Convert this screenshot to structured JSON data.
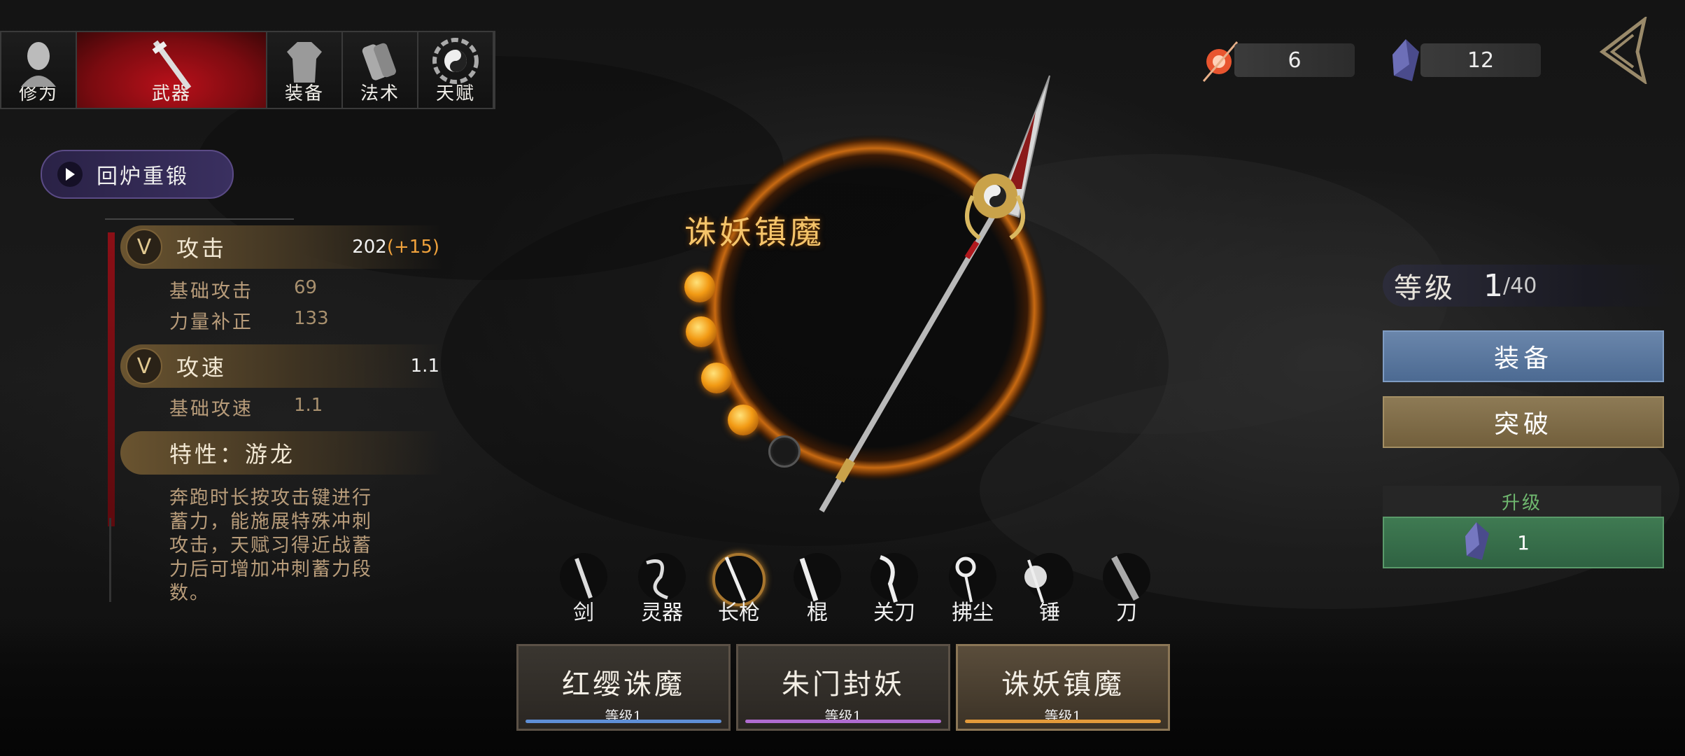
{
  "tabs": [
    {
      "label": "修为",
      "icon": "monk-portrait-icon"
    },
    {
      "label": "武器",
      "icon": "sword-icon",
      "active": true
    },
    {
      "label": "装备",
      "icon": "robe-icon"
    },
    {
      "label": "法术",
      "icon": "scroll-icon"
    },
    {
      "label": "天赋",
      "icon": "bagua-icon"
    }
  ],
  "currency": [
    {
      "icon": "fire-orb-icon",
      "value": "6"
    },
    {
      "icon": "crystal-icon",
      "value": "12"
    }
  ],
  "reforge_label": "回炉重锻",
  "stats": {
    "attack": {
      "name": "攻击",
      "value": "202",
      "bonus": "(+15)",
      "rows": [
        {
          "label": "基础攻击",
          "value": "69"
        },
        {
          "label": "力量补正",
          "value": "133"
        }
      ]
    },
    "speed": {
      "name": "攻速",
      "value": "1.1",
      "rows": [
        {
          "label": "基础攻速",
          "value": "1.1"
        }
      ]
    },
    "trait": {
      "name": "特性：游龙",
      "desc": "奔跑时长按攻击键进行蓄力，能施展特殊冲刺攻击，天赋习得近战蓄力后可增加冲刺蓄力段数。"
    }
  },
  "weapon_name": "诛妖镇魔",
  "orbs": {
    "filled": 4,
    "total": 5
  },
  "level": {
    "label": "等级",
    "current": "1",
    "max": "/40"
  },
  "equip_label": "装备",
  "break_label": "突破",
  "upgrade": {
    "label": "升级",
    "cost": "1",
    "icon": "crystal-icon"
  },
  "weapon_types": [
    {
      "label": "剑",
      "icon": "sword-icon"
    },
    {
      "label": "灵器",
      "icon": "dragon-icon"
    },
    {
      "label": "长枪",
      "icon": "spear-icon",
      "selected": true
    },
    {
      "label": "棍",
      "icon": "staff-icon"
    },
    {
      "label": "关刀",
      "icon": "glaive-icon"
    },
    {
      "label": "拂尘",
      "icon": "whisk-icon"
    },
    {
      "label": "锤",
      "icon": "hammer-icon"
    },
    {
      "label": "刀",
      "icon": "blade-icon"
    }
  ],
  "cards": [
    {
      "name": "红缨诛魔",
      "level": "等级1",
      "color": "#5f8fd6"
    },
    {
      "name": "朱门封妖",
      "level": "等级1",
      "color": "#b06cd0"
    },
    {
      "name": "诛妖镇魔",
      "level": "等级1",
      "color": "#e39a3a",
      "selected": true
    }
  ]
}
